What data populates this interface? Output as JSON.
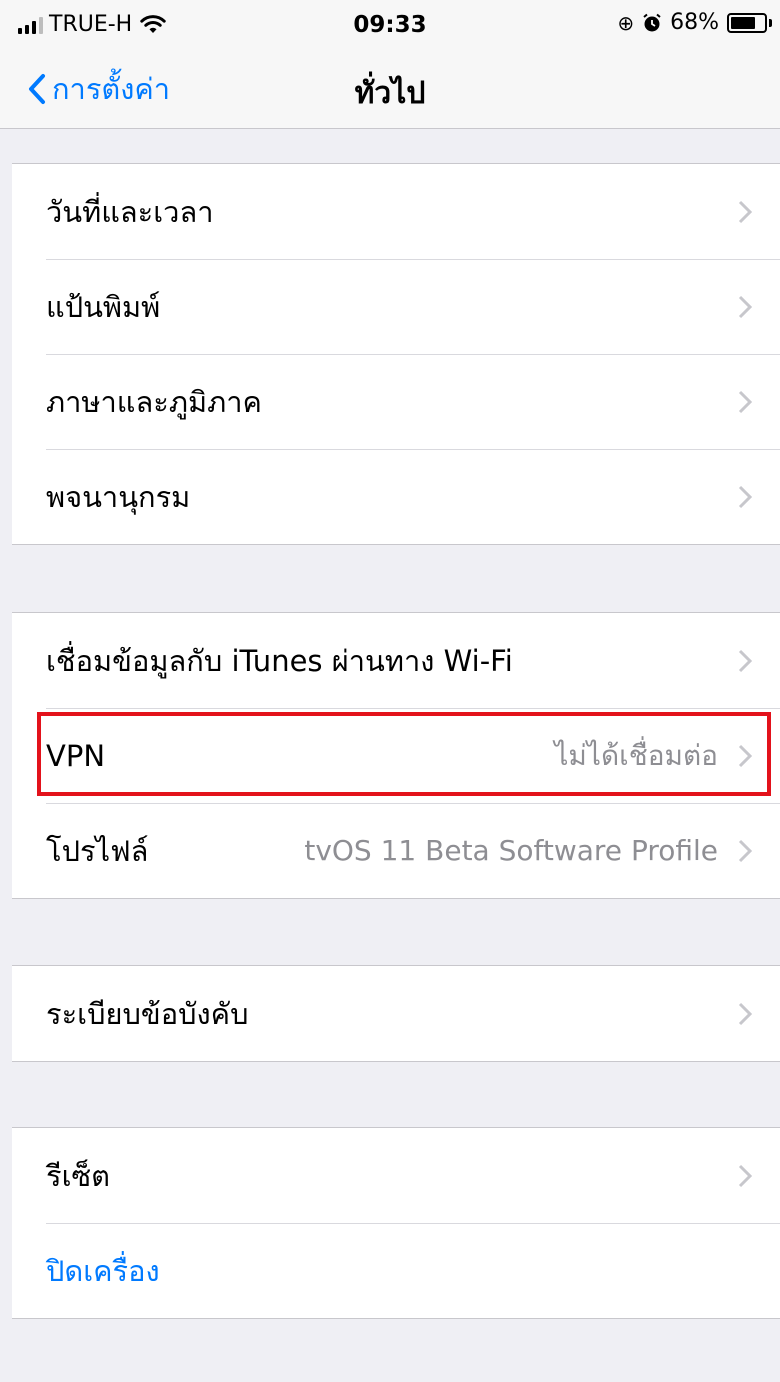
{
  "status_bar": {
    "carrier": "TRUE-H",
    "time": "09:33",
    "battery_percent": "68%",
    "battery_level": 0.68,
    "icons": [
      "signal-bars",
      "wifi-icon",
      "orientation-lock-icon",
      "alarm-icon",
      "battery-icon"
    ]
  },
  "nav": {
    "back_label": "การตั้งค่า",
    "title": "ทั่วไป"
  },
  "groups": {
    "g1": {
      "date_time": "วันที่และเวลา",
      "keyboard": "แป้นพิมพ์",
      "language_region": "ภาษาและภูมิภาค",
      "dictionary": "พจนานุกรม"
    },
    "g2": {
      "itunes_wifi_sync": "เชื่อมข้อมูลกับ iTunes ผ่านทาง Wi-Fi",
      "vpn_label": "VPN",
      "vpn_status": "ไม่ได้เชื่อมต่อ",
      "profile_label": "โปรไฟล์",
      "profile_value": "tvOS 11 Beta Software Profile"
    },
    "g3": {
      "regulatory": "ระเบียบข้อบังคับ"
    },
    "g4": {
      "reset": "รีเซ็ต",
      "shut_down": "ปิดเครื่อง"
    }
  },
  "colors": {
    "accent": "#007aff",
    "highlight_box": "#e3121b",
    "background": "#efeff4",
    "secondary_text": "#8e8e93"
  }
}
